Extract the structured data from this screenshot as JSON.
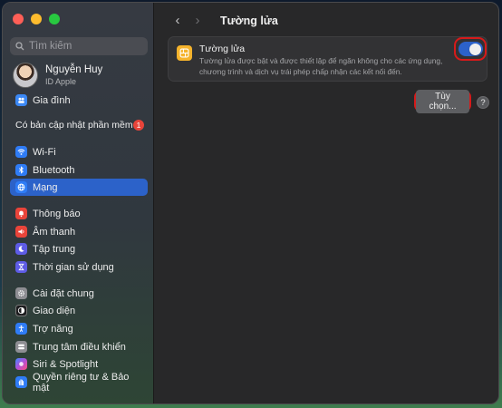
{
  "sidebar": {
    "search_placeholder": "Tìm kiếm",
    "profile": {
      "name": "Nguyễn Huy",
      "subtitle": "ID Apple"
    },
    "family": "Gia đình",
    "update": {
      "label": "Có bản cập nhật phần mềm",
      "count": "1"
    },
    "items": [
      {
        "label": "Wi-Fi",
        "icon": "wifi-icon",
        "color": "#2f7cf6"
      },
      {
        "label": "Bluetooth",
        "icon": "bluetooth-icon",
        "color": "#2f7cf6"
      },
      {
        "label": "Mạng",
        "icon": "globe-icon",
        "color": "#2f7cf6"
      },
      {
        "label": "Thông báo",
        "icon": "bell-icon",
        "color": "#e9443a"
      },
      {
        "label": "Âm thanh",
        "icon": "speaker-icon",
        "color": "#e9443a"
      },
      {
        "label": "Tập trung",
        "icon": "moon-icon",
        "color": "#5e5ce6"
      },
      {
        "label": "Thời gian sử dụng",
        "icon": "hourglass-icon",
        "color": "#5e5ce6"
      },
      {
        "label": "Cài đặt chung",
        "icon": "gear-icon",
        "color": "#8e8e93"
      },
      {
        "label": "Giao diện",
        "icon": "appearance-icon",
        "color": "#1c1c1e"
      },
      {
        "label": "Trợ năng",
        "icon": "accessibility-icon",
        "color": "#2f7cf6"
      },
      {
        "label": "Trung tâm điều khiển",
        "icon": "control-center-icon",
        "color": "#8e8e93"
      },
      {
        "label": "Siri & Spotlight",
        "icon": "siri-icon",
        "color": "#b24fd8"
      },
      {
        "label": "Quyền riêng tư & Bảo mật",
        "icon": "hand-icon",
        "color": "#2f7cf6"
      }
    ],
    "active_item": "Mạng"
  },
  "header": {
    "title": "Tường lửa",
    "back_icon": "chevron-left-icon",
    "forward_icon": "chevron-right-icon"
  },
  "firewall": {
    "title": "Tường lửa",
    "description": "Tường lửa được bật và được thiết lập để ngăn không cho các ứng dụng, chương trình và dịch vụ trái phép chấp nhận các kết nối đến.",
    "enabled": true,
    "icon": "firewall-icon",
    "icon_color": "#f5b32c"
  },
  "options_button": "Tùy chọn...",
  "help_button": "?",
  "colors": {
    "accent": "#2c62c9",
    "highlight": "#d61a1a"
  }
}
